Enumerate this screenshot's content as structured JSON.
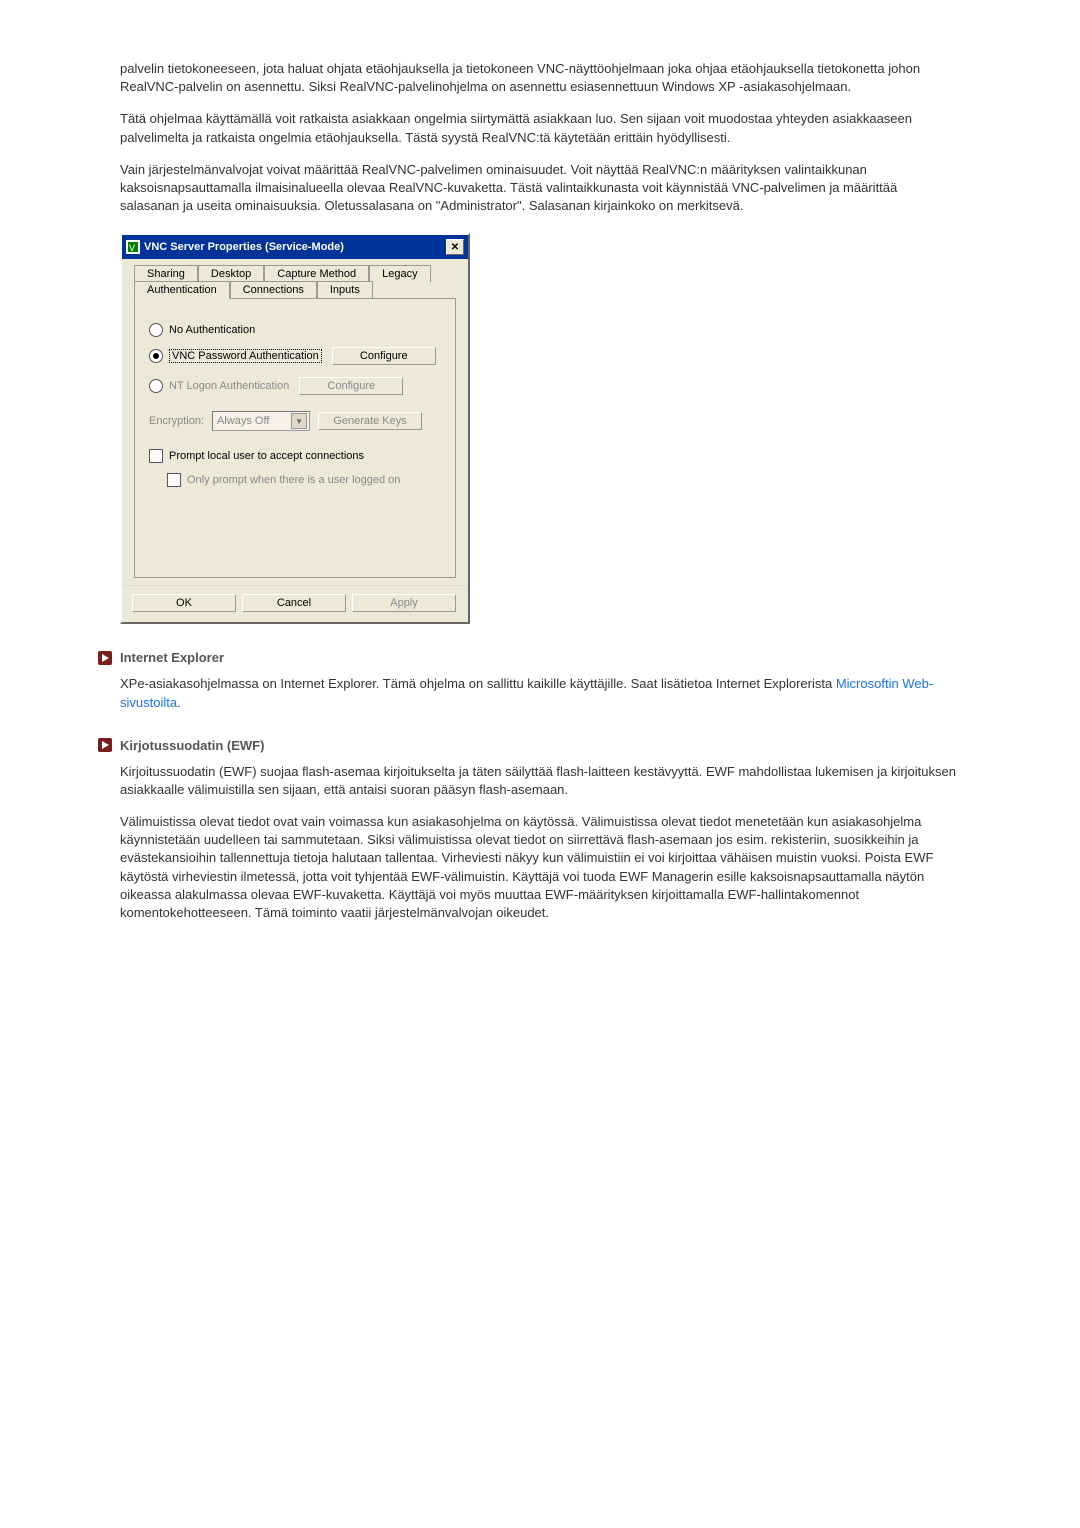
{
  "intro": {
    "p1": "palvelin tietokoneeseen, jota haluat ohjata etäohjauksella ja tietokoneen VNC-näyttöohjelmaan joka ohjaa etäohjauksella tietokonetta johon RealVNC-palvelin on asennettu. Siksi RealVNC-palvelinohjelma on asennettu esiasennettuun Windows XP -asiakasohjelmaan.",
    "p2": "Tätä ohjelmaa käyttämällä voit ratkaista asiakkaan ongelmia siirtymättä asiakkaan luo. Sen sijaan voit muodostaa yhteyden asiakkaaseen palvelimelta ja ratkaista ongelmia etäohjauksella. Tästä syystä RealVNC:tä käytetään erittäin hyödyllisesti.",
    "p3": "Vain järjestelmänvalvojat voivat määrittää RealVNC-palvelimen ominaisuudet. Voit näyttää RealVNC:n määrityksen valintaikkunan kaksoisnapsauttamalla ilmaisinalueella olevaa RealVNC-kuvaketta. Tästä valintaikkunasta voit käynnistää VNC-palvelimen ja määrittää salasanan ja useita ominaisuuksia. Oletussalasana on \"Administrator\". Salasanan kirjainkoko on merkitsevä."
  },
  "dialog": {
    "title": "VNC Server Properties (Service-Mode)",
    "tabs_back": [
      "Sharing",
      "Desktop",
      "Capture Method",
      "Legacy"
    ],
    "tabs_front": [
      "Authentication",
      "Connections",
      "Inputs"
    ],
    "radios": {
      "none": "No Authentication",
      "vncpw": "VNC Password Authentication",
      "ntlogon": "NT Logon Authentication"
    },
    "configure": "Configure",
    "encryption_label": "Encryption:",
    "encryption_value": "Always Off",
    "genkeys": "Generate Keys",
    "prompt_local": "Prompt local user to accept connections",
    "only_prompt": "Only prompt when there is a user logged on",
    "ok": "OK",
    "cancel": "Cancel",
    "apply": "Apply"
  },
  "ie": {
    "title": "Internet Explorer",
    "p_before_link": "XPe-asiakasohjelmassa on Internet Explorer. Tämä ohjelma on sallittu kaikille käyttäjille. Saat lisätietoa Internet Explorerista ",
    "link_text": "Microsoftin Web-sivustoilta",
    "p_after_link": "."
  },
  "ewf": {
    "title": "Kirjotussuodatin (EWF)",
    "p1": "Kirjoitussuodatin (EWF) suojaa flash-asemaa kirjoitukselta ja täten säilyttää flash-laitteen kestävyyttä. EWF mahdollistaa lukemisen ja kirjoituksen asiakkaalle välimuistilla sen sijaan, että antaisi suoran pääsyn flash-asemaan.",
    "p2": "Välimuistissa olevat tiedot ovat vain voimassa kun asiakasohjelma on käytössä. Välimuistissa olevat tiedot menetetään kun asiakasohjelma käynnistetään uudelleen tai sammutetaan. Siksi välimuistissa olevat tiedot on siirrettävä flash-asemaan jos esim. rekisteriin, suosikkeihin ja evästekansioihin tallennettuja tietoja halutaan tallentaa. Virheviesti näkyy kun välimuistiin ei voi kirjoittaa vähäisen muistin vuoksi. Poista EWF käytöstä virheviestin ilmetessä, jotta voit tyhjentää EWF-välimuistin. Käyttäjä voi tuoda EWF Managerin esille kaksoisnapsauttamalla näytön oikeassa alakulmassa olevaa EWF-kuvaketta. Käyttäjä voi myös muuttaa EWF-määrityksen kirjoittamalla EWF-hallintakomennot komentokehotteeseen. Tämä toiminto vaatii järjestelmänvalvojan oikeudet."
  }
}
